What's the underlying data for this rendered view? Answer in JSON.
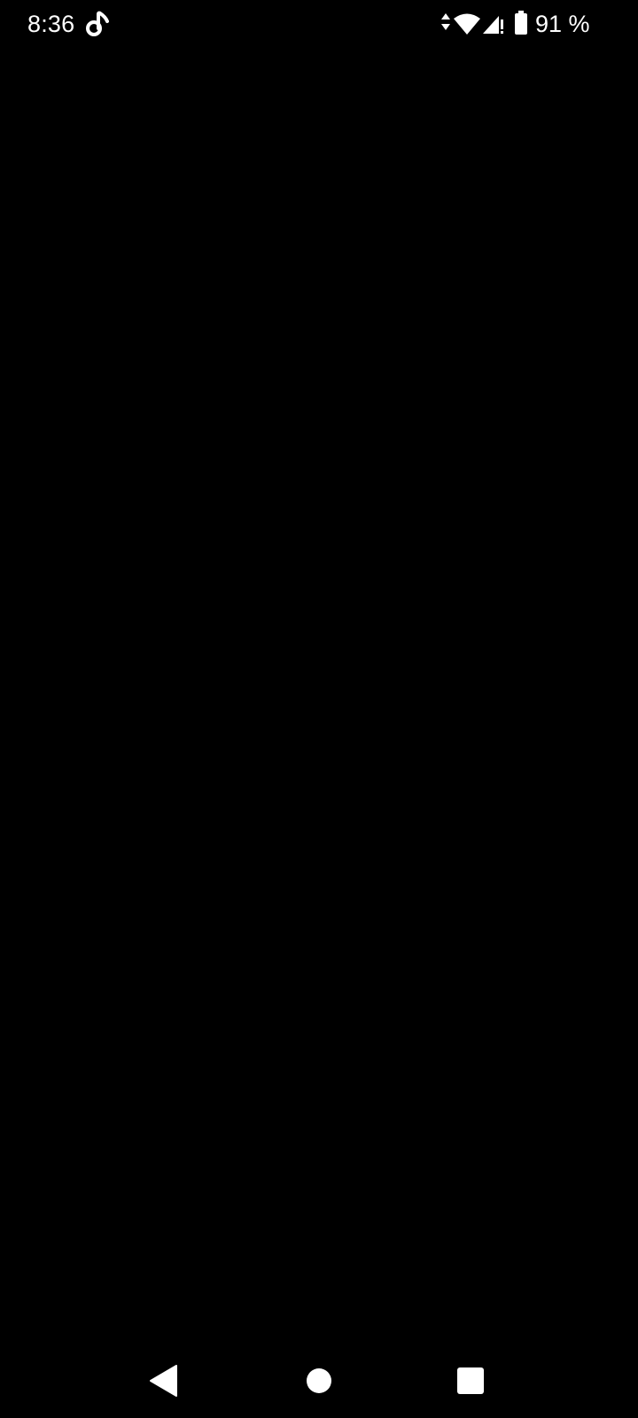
{
  "status_bar": {
    "time": "8:36",
    "battery_text": "91 %",
    "icons": [
      "music-note-icon",
      "data-transfer-icon",
      "wifi-icon",
      "cell-signal-icon",
      "battery-icon"
    ]
  },
  "nav_bar": {
    "buttons": [
      "back-icon",
      "home-icon",
      "recents-icon"
    ]
  },
  "colors": {
    "background": "#000000",
    "foreground": "#ffffff"
  }
}
